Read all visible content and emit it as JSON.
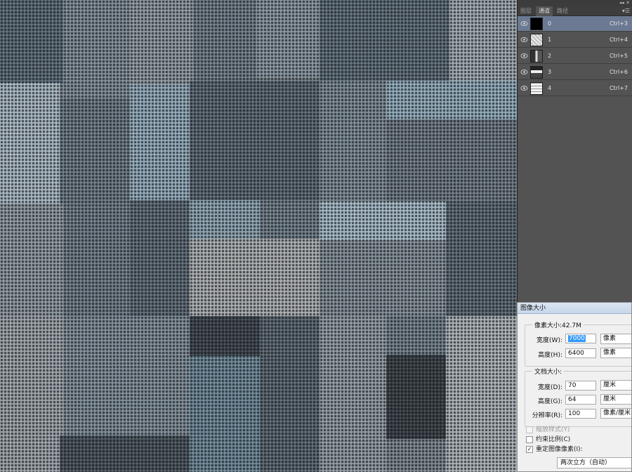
{
  "panel": {
    "tabs": [
      {
        "label": "图层",
        "active": false
      },
      {
        "label": "通道",
        "active": true
      },
      {
        "label": "路径",
        "active": false
      }
    ],
    "collapse_icon": "double-chevron-right-icon",
    "menu_icon": "panel-menu-icon",
    "channels": [
      {
        "name": "0",
        "shortcut": "Ctrl+3",
        "selected": true,
        "thumb_color": "#000000"
      },
      {
        "name": "1",
        "shortcut": "Ctrl+4",
        "selected": false,
        "thumb_color": "#d8d8d8"
      },
      {
        "name": "2",
        "shortcut": "Ctrl+5",
        "selected": false,
        "thumb_color": "#5a5a5a"
      },
      {
        "name": "3",
        "shortcut": "Ctrl+6",
        "selected": false,
        "thumb_color": "#7a7a7a"
      },
      {
        "name": "4",
        "shortcut": "Ctrl+7",
        "selected": false,
        "thumb_color": "#e6e6e6"
      }
    ]
  },
  "dialog": {
    "title": "图像大小",
    "pixel_dimensions_label": "像素大小:42.7M",
    "width_label": "宽度(W):",
    "width_value": "7000",
    "width_unit": "像素",
    "height_label": "高度(H):",
    "height_value": "6400",
    "height_unit": "像素",
    "document_size_label": "文档大小:",
    "doc_width_label": "宽度(D):",
    "doc_width_value": "70",
    "doc_width_unit": "厘米",
    "doc_height_label": "高度(G):",
    "doc_height_value": "64",
    "doc_height_unit": "厘米",
    "resolution_label": "分辨率(R):",
    "resolution_value": "100",
    "resolution_unit": "像素/厘米",
    "scale_styles_label": "缩放样式(Y)",
    "scale_styles_checked": false,
    "constrain_label": "约束比例(C)",
    "constrain_checked": false,
    "resample_label": "重定图像像素(I):",
    "resample_checked": true,
    "resample_method": "两次立方（自动）",
    "check_mark": "✓"
  },
  "colors": {
    "selected_row": "#6b7a92",
    "panel_bg": "#535353",
    "highlight": "#3399ff"
  }
}
